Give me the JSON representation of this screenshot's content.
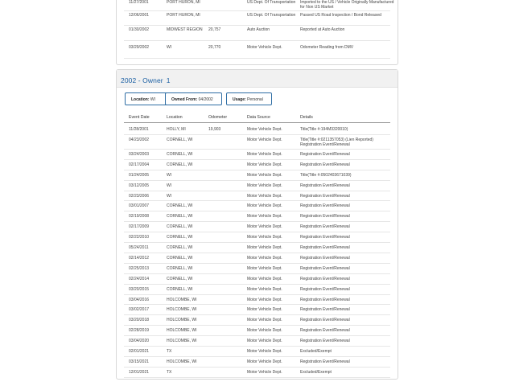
{
  "prev_owner": {
    "records": [
      {
        "date": "11/27/2001",
        "location": "PORT HURON, MI",
        "odometer": "",
        "source": "US Dept. Of Transportation",
        "details": "Imported to the US / Vehicle Originally Manufactured for Non US Market"
      },
      {
        "date": "12/06/2001",
        "location": "PORT HURON, MI",
        "odometer": "",
        "source": "US Dept. Of Transportation",
        "details": "Passed US Road Inspection / Bond Released"
      },
      {
        "date": "01/30/2002",
        "location": "MIDWEST REGION",
        "odometer": "20,757",
        "source": "Auto Auction",
        "details": "Reported at Auto Auction"
      },
      {
        "date": "03/29/2002",
        "location": "WI",
        "odometer": "20,770",
        "source": "Motor Vehicle Dept.",
        "details": "Odometer Reading from DMV"
      }
    ]
  },
  "owner": {
    "year": "2002 - Owner",
    "number": "1",
    "chips": {
      "location_key": "Location",
      "location_val": "WI",
      "owned_key": "Owned From",
      "owned_val": "04/2002",
      "usage_key": "Usage",
      "usage_val": "Personal"
    },
    "columns": {
      "date": "Event Date",
      "location": "Location",
      "odometer": "Odometer",
      "source": "Data Source",
      "details": "Details"
    },
    "records": [
      {
        "date": "11/28/2001",
        "location": "HOLLY, MI",
        "odometer": "19,903",
        "source": "Motor Vehicle Dept.",
        "details": "Title(Title #:194M3320010)"
      },
      {
        "date": "04/23/2002",
        "location": "CORNELL, WI",
        "odometer": "",
        "source": "Motor Vehicle Dept.",
        "details": "Title(Title #:0211357053) (Lien Reported) Registration Event/Renewal"
      },
      {
        "date": "03/24/2003",
        "location": "CORNELL, WI",
        "odometer": "",
        "source": "Motor Vehicle Dept.",
        "details": "Registration Event/Renewal"
      },
      {
        "date": "02/17/2004",
        "location": "CORNELL, WI",
        "odometer": "",
        "source": "Motor Vehicle Dept.",
        "details": "Registration Event/Renewal"
      },
      {
        "date": "01/24/2005",
        "location": "WI",
        "odometer": "",
        "source": "Motor Vehicle Dept.",
        "details": "Title(Title #:0502403671039)"
      },
      {
        "date": "03/12/2005",
        "location": "WI",
        "odometer": "",
        "source": "Motor Vehicle Dept.",
        "details": "Registration Event/Renewal"
      },
      {
        "date": "02/23/2006",
        "location": "WI",
        "odometer": "",
        "source": "Motor Vehicle Dept.",
        "details": "Registration Event/Renewal"
      },
      {
        "date": "03/01/2007",
        "location": "CORNELL, WI",
        "odometer": "",
        "source": "Motor Vehicle Dept.",
        "details": "Registration Event/Renewal"
      },
      {
        "date": "02/19/2008",
        "location": "CORNELL, WI",
        "odometer": "",
        "source": "Motor Vehicle Dept.",
        "details": "Registration Event/Renewal"
      },
      {
        "date": "02/17/2009",
        "location": "CORNELL, WI",
        "odometer": "",
        "source": "Motor Vehicle Dept.",
        "details": "Registration Event/Renewal"
      },
      {
        "date": "02/22/2010",
        "location": "CORNELL, WI",
        "odometer": "",
        "source": "Motor Vehicle Dept.",
        "details": "Registration Event/Renewal"
      },
      {
        "date": "05/24/2011",
        "location": "CORNELL, WI",
        "odometer": "",
        "source": "Motor Vehicle Dept.",
        "details": "Registration Event/Renewal"
      },
      {
        "date": "02/14/2012",
        "location": "CORNELL, WI",
        "odometer": "",
        "source": "Motor Vehicle Dept.",
        "details": "Registration Event/Renewal"
      },
      {
        "date": "02/25/2013",
        "location": "CORNELL, WI",
        "odometer": "",
        "source": "Motor Vehicle Dept.",
        "details": "Registration Event/Renewal"
      },
      {
        "date": "02/24/2014",
        "location": "CORNELL, WI",
        "odometer": "",
        "source": "Motor Vehicle Dept.",
        "details": "Registration Event/Renewal"
      },
      {
        "date": "03/20/2015",
        "location": "CORNELL, WI",
        "odometer": "",
        "source": "Motor Vehicle Dept.",
        "details": "Registration Event/Renewal"
      },
      {
        "date": "03/04/2016",
        "location": "HOLCOMBE, WI",
        "odometer": "",
        "source": "Motor Vehicle Dept.",
        "details": "Registration Event/Renewal"
      },
      {
        "date": "03/02/2017",
        "location": "HOLCOMBE, WI",
        "odometer": "",
        "source": "Motor Vehicle Dept.",
        "details": "Registration Event/Renewal"
      },
      {
        "date": "03/20/2018",
        "location": "HOLCOMBE, WI",
        "odometer": "",
        "source": "Motor Vehicle Dept.",
        "details": "Registration Event/Renewal"
      },
      {
        "date": "02/28/2019",
        "location": "HOLCOMBE, WI",
        "odometer": "",
        "source": "Motor Vehicle Dept.",
        "details": "Registration Event/Renewal"
      },
      {
        "date": "03/04/2020",
        "location": "HOLCOMBE, WI",
        "odometer": "",
        "source": "Motor Vehicle Dept.",
        "details": "Registration Event/Renewal"
      },
      {
        "date": "02/01/2021",
        "location": "TX",
        "odometer": "",
        "source": "Motor Vehicle Dept.",
        "details": "Excluded/Exempt"
      },
      {
        "date": "03/15/2021",
        "location": "HOLCOMBE, WI",
        "odometer": "",
        "source": "Motor Vehicle Dept.",
        "details": "Registration Event/Renewal"
      },
      {
        "date": "12/01/2021",
        "location": "TX",
        "odometer": "",
        "source": "Motor Vehicle Dept.",
        "details": "Excluded/Exempt"
      }
    ]
  }
}
